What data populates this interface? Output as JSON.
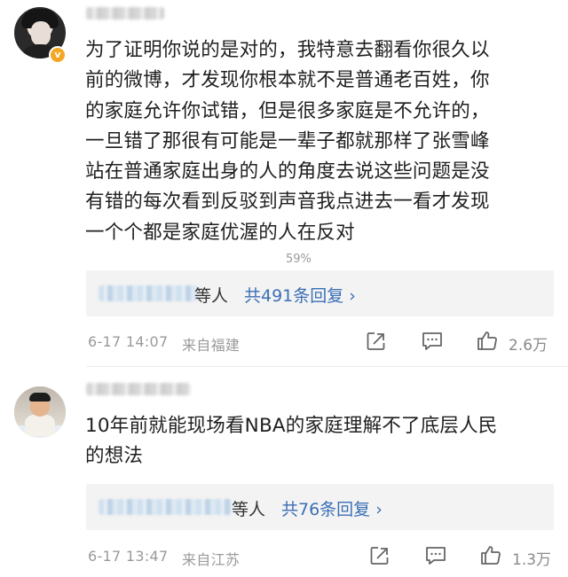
{
  "comments": [
    {
      "text_lines": [
        "为了证明你说的是对的，我特意去翻看你很久以",
        "前的微博，才发现你根本就不是普通老百姓，你",
        "的家庭允许你试错，但是很多家庭是不允许的，",
        "一旦错了那很有可能是一辈子都就那样了张雪峰",
        "站在普通家庭出身的人的角度去说这些问题是没",
        "有错的每次看到反驳到声音我点进去一看才发现",
        "一个个都是家庭优渥的人在反对"
      ],
      "overlay_percent": "59%",
      "verified_badge": "v",
      "reply_who": "等人",
      "reply_count": "共491条回复 ›",
      "time": "6-17 14:07",
      "location": "来自福建",
      "likes": "2.6万"
    },
    {
      "text_lines": [
        "10年前就能现场看NBA的家庭理解不了底层人民",
        "的想法"
      ],
      "reply_who": "等人",
      "reply_count": "共76条回复 ›",
      "time": "6-17 13:47",
      "location": "来自江苏",
      "likes": "1.3万"
    }
  ],
  "icons": [
    "share-icon",
    "comment-icon",
    "like-icon"
  ],
  "colors": {
    "link": "#3b6fb6",
    "meta": "#9a9a9a",
    "reply_bg": "#f3f3f3",
    "badge": "#f5a623"
  }
}
